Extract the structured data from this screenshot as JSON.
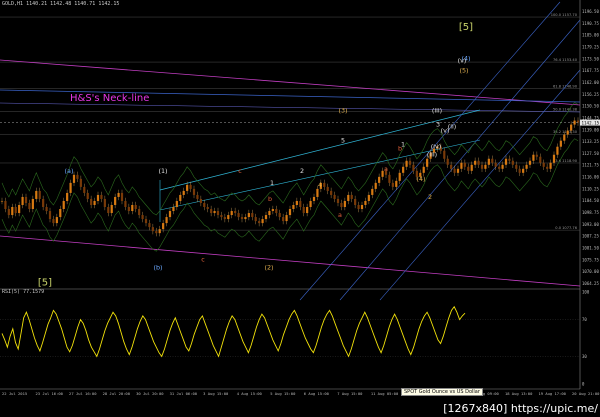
{
  "header": {
    "text": "GOLD,H1  1140.21 1142.48 1140.71 1142.15"
  },
  "rsi_label": "RSI(5) 77.1579",
  "tooltip": "SPOT Gold Ounce vs US Dollar",
  "watermark": "[1267x840] https://upic.me/",
  "annotation": "H&S's Neck-line",
  "chart_data": {
    "type": "candlestick",
    "ylim": [
      1060.7,
      1199.0
    ],
    "price_ticks": [
      "1196.50",
      "1190.75",
      "1185.00",
      "1179.25",
      "1173.50",
      "1167.75",
      "1162.00",
      "1156.25",
      "1150.50",
      "1144.75",
      "1139.00",
      "1133.25",
      "1127.50",
      "1121.75",
      "1116.00",
      "1110.25",
      "1104.50",
      "1098.75",
      "1093.00",
      "1087.25",
      "1081.50",
      "1075.75",
      "1070.00",
      "1064.25"
    ],
    "current_price": "1142.15",
    "fib_levels": [
      {
        "label": "100.0 1157.70",
        "price": 1194.5
      },
      {
        "label": "76.4 1153.40",
        "price": 1172.1
      },
      {
        "label": "61.8 1146.90",
        "price": 1158.9
      },
      {
        "label": "50.0 1140.38",
        "price": 1147.5
      },
      {
        "label": "38.2 1133.30",
        "price": 1136.2
      },
      {
        "label": "23.6 1118.90",
        "price": 1121.9
      },
      {
        "label": "0.0 1077.76",
        "price": 1088.5
      }
    ],
    "xlabels": [
      "22 Jul 2015",
      "23 Jul 16:00",
      "27 Jul 16:00",
      "28 Jul 20:00",
      "30 Jul 20:00",
      "31 Jul 06:00",
      "3 Aug 15:00",
      "4 Aug 15:00",
      "5 Aug 15:00",
      "6 Aug 15:00",
      "7 Aug 15:00",
      "11 Aug 05:00",
      "12 Aug 14:00",
      "13 Aug 13:00",
      "17 Aug 09:00",
      "18 Aug 13:00",
      "19 Aug 17:00",
      "20 Aug 21:00"
    ],
    "close": [
      1103,
      1099,
      1096,
      1100,
      1097,
      1101,
      1105,
      1102,
      1099,
      1104,
      1108,
      1104,
      1100,
      1098,
      1094,
      1092,
      1095,
      1099,
      1103,
      1107,
      1112,
      1116,
      1114,
      1110,
      1107,
      1104,
      1101,
      1103,
      1106,
      1104,
      1100,
      1097,
      1101,
      1105,
      1107,
      1103,
      1100,
      1098,
      1101,
      1099,
      1096,
      1094,
      1092,
      1090,
      1088,
      1087,
      1089,
      1092,
      1095,
      1098,
      1100,
      1103,
      1106,
      1108,
      1111,
      1109,
      1106,
      1104,
      1102,
      1100,
      1099,
      1097,
      1098,
      1096,
      1095,
      1094,
      1096,
      1098,
      1097,
      1095,
      1094,
      1095,
      1097,
      1095,
      1093,
      1092,
      1094,
      1096,
      1098,
      1099,
      1097,
      1095,
      1093,
      1096,
      1099,
      1101,
      1103,
      1100,
      1097,
      1100,
      1103,
      1105,
      1109,
      1112,
      1110,
      1108,
      1106,
      1104,
      1102,
      1100,
      1103,
      1106,
      1104,
      1101,
      1099,
      1101,
      1103,
      1106,
      1109,
      1112,
      1115,
      1118,
      1116,
      1112,
      1110,
      1113,
      1117,
      1120,
      1123,
      1121,
      1118,
      1115,
      1117,
      1120,
      1124,
      1127,
      1129,
      1130,
      1128,
      1124,
      1121,
      1119,
      1117,
      1119,
      1122,
      1120,
      1118,
      1121,
      1123,
      1121,
      1119,
      1121,
      1124,
      1122,
      1120,
      1119,
      1121,
      1124,
      1123,
      1121,
      1119,
      1117,
      1119,
      1121,
      1123,
      1126,
      1125,
      1122,
      1120,
      1119,
      1122,
      1126,
      1130,
      1133,
      1136,
      1138,
      1141,
      1143,
      1142
    ],
    "waves": [
      {
        "label": "[5]",
        "price": 1188,
        "color": "#c8d26a",
        "kind": "big"
      },
      {
        "label": "(4)",
        "price": 1173,
        "color": "#6aa8ff"
      },
      {
        "label": "(5)",
        "price": 1167,
        "color": "#e0b050"
      },
      {
        "label": "(3)",
        "price": 1147,
        "color": "#e0b050"
      },
      {
        "label": "(a)",
        "price": 1117,
        "color": "#6aa8ff"
      },
      {
        "label": "(1)",
        "price": 1117,
        "color": "#e0e0e0"
      },
      {
        "label": "(b)",
        "price": 1069,
        "color": "#6aa8ff"
      },
      {
        "label": "(2)",
        "price": 1069,
        "color": "#e0b050"
      },
      {
        "label": "(4)",
        "price": 1113,
        "color": "#e0b050"
      },
      {
        "label": "[5]",
        "price": 1061,
        "color": "#c8d26a",
        "kind": "big"
      },
      {
        "label": "5",
        "price": 1132,
        "color": "#e0e0e0"
      },
      {
        "label": "3",
        "price": 1140,
        "color": "#e0e0e0"
      },
      {
        "label": "4",
        "price": 1110,
        "color": "#e0b050"
      },
      {
        "label": "2",
        "price": 1104,
        "color": "#e0b050"
      },
      {
        "label": "1",
        "price": 1111,
        "color": "#e0e0e0"
      },
      {
        "label": "1",
        "price": 1130,
        "color": "#e0e0e0"
      },
      {
        "label": "2",
        "price": 1117,
        "color": "#e0e0e0"
      },
      {
        "label": "a",
        "price": 1118,
        "color": "#e0603a"
      },
      {
        "label": "b",
        "price": 1128,
        "color": "#e0603a"
      },
      {
        "label": "c",
        "price": 1117,
        "color": "#e0603a"
      },
      {
        "label": "a",
        "price": 1095,
        "color": "#e0603a"
      },
      {
        "label": "b",
        "price": 1103,
        "color": "#e0603a"
      },
      {
        "label": "c",
        "price": 1073,
        "color": "#e0603a"
      },
      {
        "label": "(iii)",
        "price": 1147,
        "color": "#e0e0e0"
      },
      {
        "label": "(iv)",
        "price": 1129,
        "color": "#e0e0e0"
      },
      {
        "label": "(v)",
        "price": 1137,
        "color": "#e0e0e0"
      },
      {
        "label": "(ii)",
        "price": 1139,
        "color": "#e0e0e0"
      },
      {
        "label": "(iii)",
        "price": 1125,
        "color": "#e0e0e0"
      },
      {
        "label": "(v)",
        "price": 1172,
        "color": "#e0e0e0"
      }
    ],
    "rsi": [
      55,
      48,
      40,
      52,
      60,
      45,
      38,
      55,
      72,
      78,
      70,
      60,
      50,
      42,
      36,
      45,
      55,
      65,
      72,
      80,
      76,
      68,
      60,
      50,
      40,
      35,
      42,
      52,
      62,
      70,
      66,
      58,
      48,
      40,
      35,
      30,
      38,
      48,
      58,
      66,
      72,
      78,
      74,
      66,
      56,
      46,
      38,
      32,
      40,
      50,
      60,
      68,
      74,
      70,
      62,
      54,
      46,
      40,
      34,
      30,
      38,
      48,
      58,
      66,
      72,
      64,
      56,
      48,
      40,
      36,
      44,
      54,
      62,
      70,
      74,
      66,
      58,
      50,
      42,
      36,
      30,
      40,
      50,
      60,
      68,
      74,
      70,
      62,
      54,
      46,
      40,
      34,
      42,
      52,
      62,
      70,
      76,
      72,
      64,
      56,
      48,
      42,
      36,
      44,
      54,
      62,
      70,
      76,
      80,
      74,
      66,
      58,
      50,
      44,
      38,
      34,
      42,
      52,
      62,
      70,
      76,
      80,
      74,
      66,
      58,
      50,
      42,
      36,
      30,
      38,
      48,
      58,
      66,
      72,
      78,
      72,
      64,
      56,
      48,
      40,
      34,
      42,
      52,
      62,
      70,
      76,
      70,
      62,
      54,
      46,
      38,
      32,
      40,
      50,
      60,
      68,
      74,
      78,
      72,
      64,
      56,
      48,
      44,
      52,
      62,
      72,
      80,
      84,
      78,
      70,
      74,
      77
    ]
  }
}
